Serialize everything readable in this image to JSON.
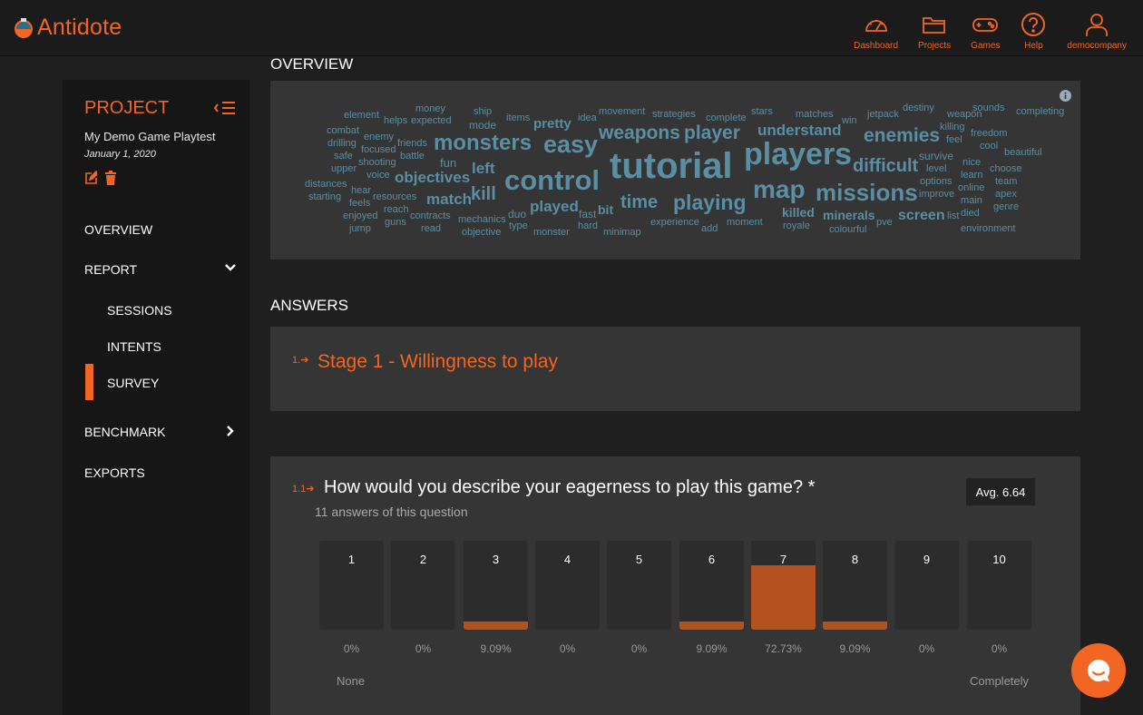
{
  "brand": {
    "name": "Antidote"
  },
  "nav": [
    {
      "label": "Dashboard",
      "icon": "gauge-icon"
    },
    {
      "label": "Projects",
      "icon": "folder-icon"
    },
    {
      "label": "Games",
      "icon": "gamepad-icon"
    },
    {
      "label": "Help",
      "icon": "help-icon"
    },
    {
      "label": "democompany",
      "icon": "user-icon"
    }
  ],
  "sidebar": {
    "title": "PROJECT",
    "project_name": "My Demo Game Playtest",
    "project_date": "January 1, 2020",
    "menu": {
      "overview": "OVERVIEW",
      "report": "REPORT",
      "sessions": "SESSIONS",
      "intents": "INTENTS",
      "survey": "SURVEY",
      "benchmark": "BENCHMARK",
      "exports": "EXPORTS"
    }
  },
  "overview": {
    "title": "OVERVIEW",
    "words": [
      "element",
      "helps",
      "expected",
      "money",
      "ship",
      "mode",
      "items",
      "pretty",
      "idea",
      "movement",
      "strategies",
      "complete",
      "stars",
      "matches",
      "win",
      "jetpack",
      "destiny",
      "weapon",
      "sounds",
      "completing",
      "combat",
      "drilling",
      "enemy",
      "safe",
      "focused",
      "friends",
      "battle",
      "upper",
      "shooting",
      "fun",
      "monsters",
      "easy",
      "weapons",
      "player",
      "understand",
      "enemies",
      "killing",
      "feel",
      "freedom",
      "cool",
      "beautiful",
      "distances",
      "starting",
      "voice",
      "objectives",
      "left",
      "tutorial",
      "players",
      "survive",
      "nice",
      "choose",
      "hear",
      "feels",
      "resources",
      "match",
      "kill",
      "control",
      "difficult",
      "level",
      "learn",
      "team",
      "enjoyed",
      "reach",
      "contracts",
      "mechanics",
      "duo",
      "played",
      "fast",
      "bit",
      "time",
      "playing",
      "map",
      "missions",
      "options",
      "online",
      "apex",
      "jump",
      "guns",
      "read",
      "objective",
      "type",
      "monster",
      "hard",
      "minimap",
      "experience",
      "add",
      "moment",
      "killed",
      "royale",
      "minerals",
      "colourful",
      "pve",
      "screen",
      "improve",
      "list",
      "main",
      "died",
      "genre",
      "environment"
    ]
  },
  "answers": {
    "title": "ANSWERS",
    "stage_number": "1.",
    "stage_title": "Stage 1 - Willingness to play",
    "question": {
      "number": "1.1",
      "text": "How would you describe your eagerness to play this game? *",
      "count_text": "11 answers of this question",
      "average": "Avg. 6.64",
      "scale": [
        {
          "label": "1",
          "percent": "0%",
          "value": 0
        },
        {
          "label": "2",
          "percent": "0%",
          "value": 0
        },
        {
          "label": "3",
          "percent": "9.09%",
          "value": 9.09
        },
        {
          "label": "4",
          "percent": "0%",
          "value": 0
        },
        {
          "label": "5",
          "percent": "0%",
          "value": 0
        },
        {
          "label": "6",
          "percent": "9.09%",
          "value": 9.09
        },
        {
          "label": "7",
          "percent": "72.73%",
          "value": 72.73
        },
        {
          "label": "8",
          "percent": "9.09%",
          "value": 9.09
        },
        {
          "label": "9",
          "percent": "0%",
          "value": 0
        },
        {
          "label": "10",
          "percent": "0%",
          "value": 0
        }
      ],
      "min_label": "None",
      "max_label": "Completely"
    }
  },
  "colors": {
    "accent": "#f26522",
    "bar_fill": "#b5501f",
    "word": "#5a8ea3"
  }
}
